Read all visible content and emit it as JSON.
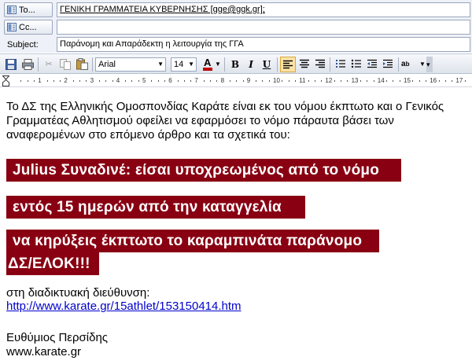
{
  "header": {
    "to_label": "To...",
    "to_value": "ΓΕΝΙΚΗ ΓΡΑΜΜΑΤΕΙΑ ΚΥΒΕΡΝΗΣΗΣ [gge@ggk.gr];",
    "cc_label": "Cc...",
    "cc_value": "",
    "subject_label": "Subject:",
    "subject_value": "Παράνομη και Απαράδεκτη η λειτουργία της ΓΓΑ"
  },
  "toolbar": {
    "font_name": "Arial",
    "font_size": "14",
    "font_color_label": "A",
    "bold": "B",
    "italic": "I",
    "underline": "U"
  },
  "ruler": {
    "numbers": [
      "1",
      "2",
      "3",
      "4",
      "5",
      "6",
      "7",
      "8",
      "9",
      "10",
      "11",
      "12",
      "13",
      "14",
      "15",
      "16",
      "17"
    ]
  },
  "message": {
    "intro": "Το ΔΣ της Ελληνικής Ομοσπονδίας Καράτε είναι εκ του νόμου έκπτωτο και ο Γενικός Γραμματέας Αθλητισμού οφείλει να εφαρμόσει το νόμο πάραυτα βάσει των αναφερομένων στο επόμενο άρθρο και τα σχετικά του:",
    "highlight_1": "Julius Συναδινέ: είσαι υποχρεωμένος από το νόμο",
    "highlight_2": "εντός 15 ημερών από την καταγγελία",
    "highlight_3": "να κηρύξεις έκπτωτο το καραμπινάτα παράνομο",
    "highlight_4": "ΔΣ/ΕΛΟΚ!!!",
    "address_label": "στη διαδικτυακή διεύθυνση:",
    "link": "http://www.karate.gr/15athlet/153150414.htm",
    "signature_name": "Ευθύμιος Περσίδης",
    "signature_site": "www.karate.gr"
  },
  "colors": {
    "highlight_bg": "#880012",
    "link": "#0000cc"
  }
}
